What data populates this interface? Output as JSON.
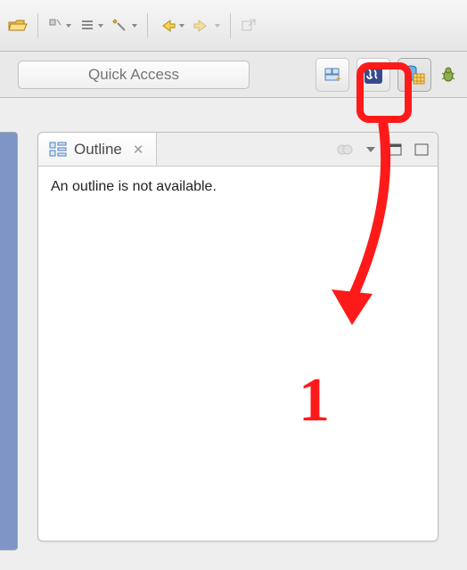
{
  "toolbar": {
    "buttons": {
      "open": "open-folder-icon",
      "dropdown1": "wand-dropdown-icon",
      "dropdown2": "list-dropdown-icon",
      "wand": "new-wand-icon",
      "back": "back-icon",
      "forward": "forward-icon",
      "external": "external-tool-icon"
    }
  },
  "search": {
    "placeholder": "Quick Access"
  },
  "perspectives": {
    "open_label": "open-perspective-icon",
    "items": [
      {
        "name": "java-perspective"
      },
      {
        "name": "db-perspective"
      },
      {
        "name": "debug-perspective"
      }
    ]
  },
  "outline": {
    "title": "Outline",
    "message": "An outline is not available."
  },
  "annotation": {
    "number": "1"
  }
}
